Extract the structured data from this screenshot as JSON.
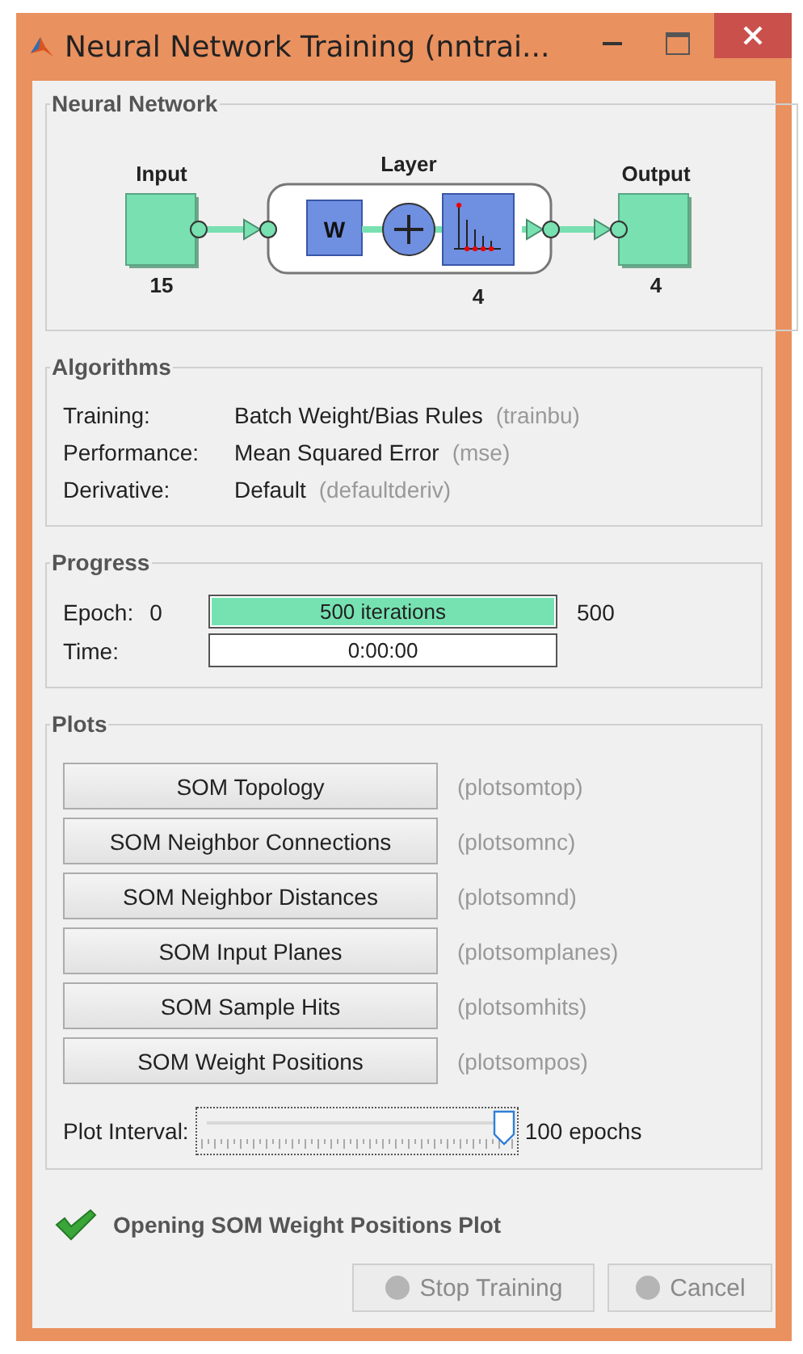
{
  "window": {
    "title": "Neural Network Training (nntrai..."
  },
  "network": {
    "title": "Neural Network",
    "input": {
      "label": "Input",
      "size": "15"
    },
    "layer": {
      "label": "Layer",
      "weight_symbol": "W",
      "size": "4"
    },
    "output": {
      "label": "Output",
      "size": "4"
    }
  },
  "algorithms": {
    "title": "Algorithms",
    "rows": [
      {
        "label": "Training:",
        "value": "Batch Weight/Bias Rules",
        "function": "(trainbu)"
      },
      {
        "label": "Performance:",
        "value": "Mean Squared Error",
        "function": "(mse)"
      },
      {
        "label": "Derivative:",
        "value": "Default",
        "function": "(defaultderiv)"
      }
    ]
  },
  "progress": {
    "title": "Progress",
    "rows": [
      {
        "label": "Epoch:",
        "start": "0",
        "text": "500 iterations",
        "level": 1,
        "end": "500"
      },
      {
        "label": "Time:",
        "text": "0:00:00"
      }
    ]
  },
  "plots": {
    "title": "Plots",
    "buttons": [
      {
        "label": "SOM Topology",
        "function": "(plotsomtop)"
      },
      {
        "label": "SOM Neighbor Connections",
        "function": "(plotsomnc)"
      },
      {
        "label": "SOM Neighbor Distances",
        "function": "(plotsomnd)"
      },
      {
        "label": "SOM Input Planes",
        "function": "(plotsomplanes)"
      },
      {
        "label": "SOM Sample Hits",
        "function": "(plotsomhits)"
      },
      {
        "label": "SOM Weight Positions",
        "function": "(plotsompos)"
      }
    ],
    "interval": {
      "label": "Plot Interval:",
      "level": 1,
      "reading": "100 epochs"
    }
  },
  "status": {
    "text": "Opening SOM Weight Positions Plot",
    "done": true
  },
  "buttons": [
    {
      "label": "Stop Training",
      "disabled": true
    },
    {
      "label": "Cancel",
      "disabled": true
    }
  ]
}
